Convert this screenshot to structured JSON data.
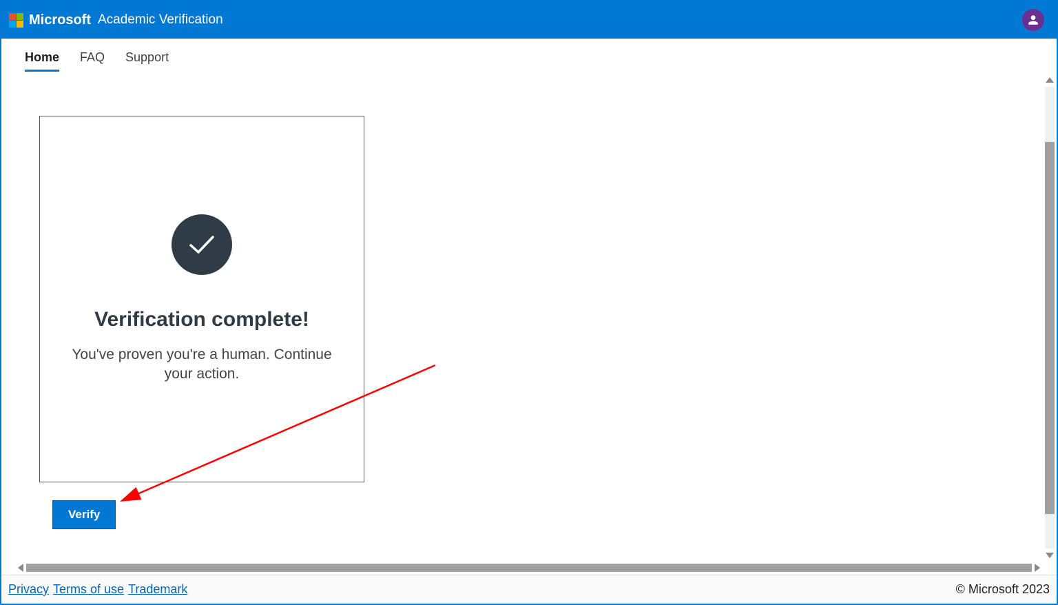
{
  "header": {
    "brand": "Microsoft",
    "title": "Academic Verification"
  },
  "nav": {
    "items": [
      {
        "label": "Home",
        "active": true
      },
      {
        "label": "FAQ",
        "active": false
      },
      {
        "label": "Support",
        "active": false
      }
    ]
  },
  "card": {
    "title": "Verification complete!",
    "text": "You've proven you're a human. Continue your action."
  },
  "actions": {
    "verify_label": "Verify"
  },
  "footer": {
    "links": [
      {
        "label": "Privacy"
      },
      {
        "label": "Terms of use"
      },
      {
        "label": "Trademark"
      }
    ],
    "copyright": "© Microsoft 2023"
  }
}
